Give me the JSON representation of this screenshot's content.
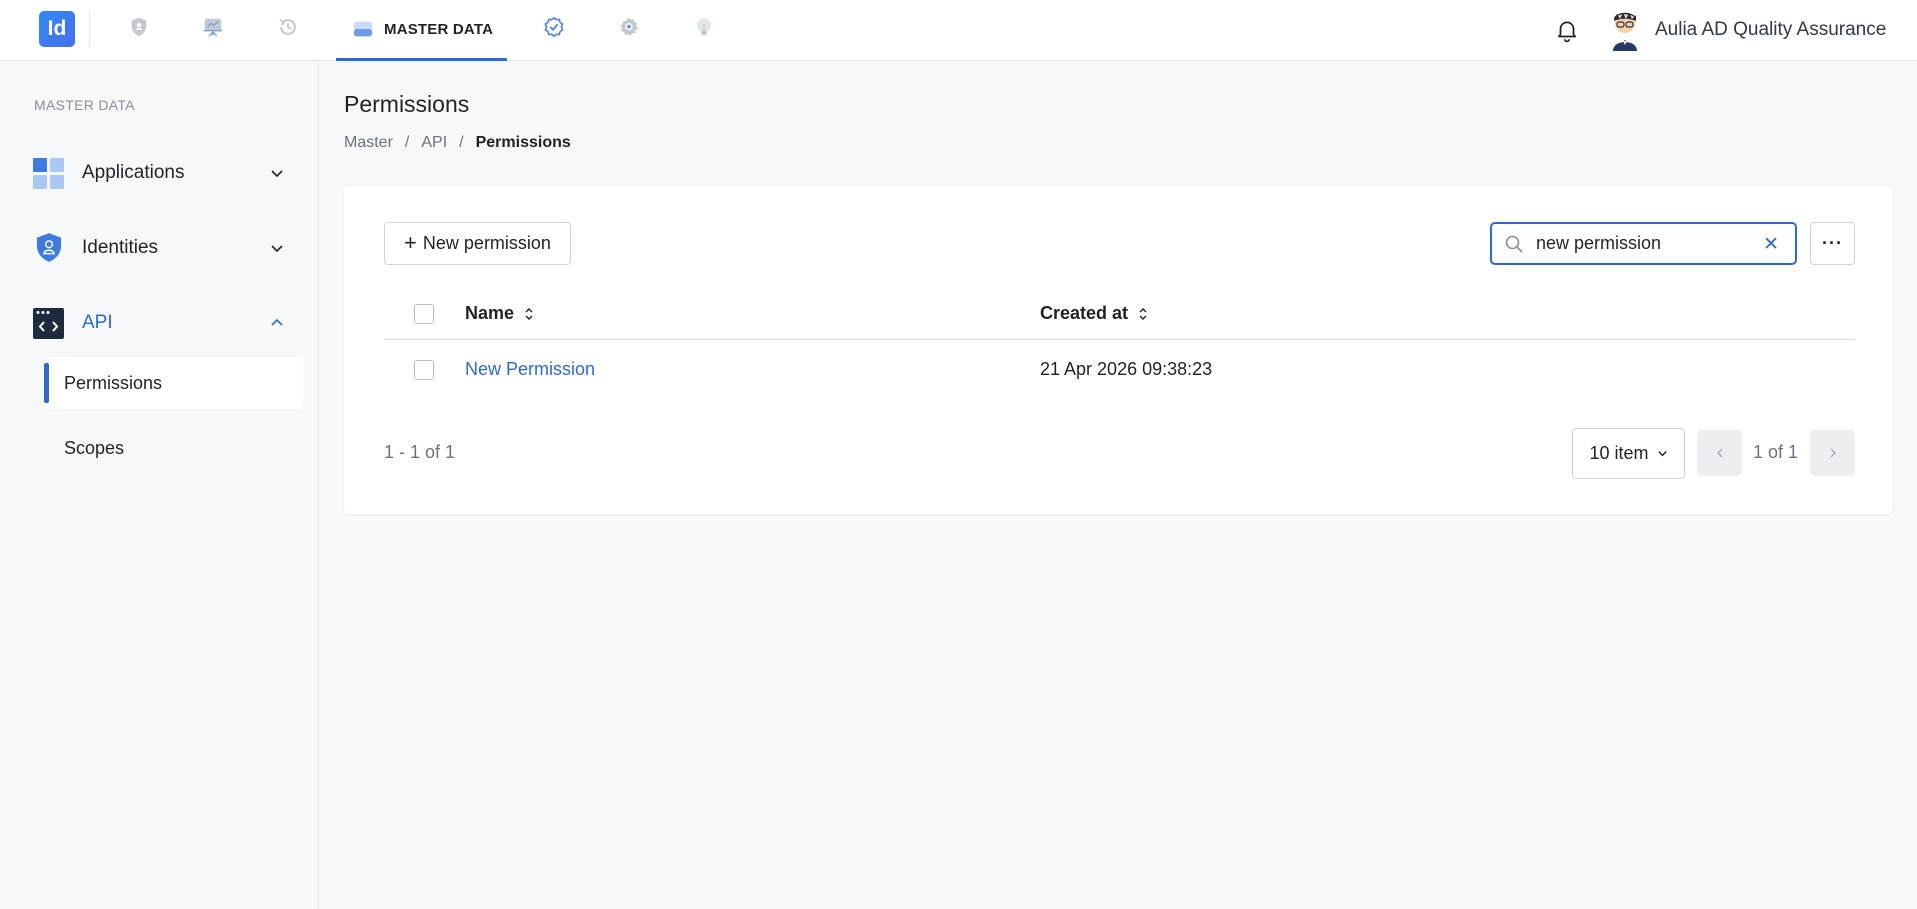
{
  "app": {
    "logo_text": "Id"
  },
  "topnav": {
    "items": [
      {
        "icon": "shield-icon"
      },
      {
        "icon": "presentation-icon"
      },
      {
        "icon": "history-icon"
      },
      {
        "icon": "database-icon",
        "label": "MASTER DATA",
        "active": true
      },
      {
        "icon": "check-badge-icon"
      },
      {
        "icon": "gear-icon"
      },
      {
        "icon": "lightbulb-icon"
      }
    ],
    "user_name": "Aulia AD Quality Assurance"
  },
  "sidebar": {
    "section_title": "MASTER DATA",
    "items": [
      {
        "label": "Applications",
        "icon": "grid-apps-icon",
        "expanded": false
      },
      {
        "label": "Identities",
        "icon": "shield-user-icon",
        "expanded": false
      },
      {
        "label": "API",
        "icon": "code-window-icon",
        "expanded": true
      }
    ],
    "sub_items": [
      {
        "label": "Permissions",
        "active": true
      },
      {
        "label": "Scopes",
        "active": false
      }
    ]
  },
  "page": {
    "title": "Permissions",
    "breadcrumb": [
      "Master",
      "API",
      "Permissions"
    ]
  },
  "toolbar": {
    "new_button_label": "New permission",
    "new_button_plus": "+",
    "search_value": "new permission",
    "clear_glyph": "✕",
    "more_glyph": "···"
  },
  "table": {
    "columns": [
      "Name",
      "Created at"
    ],
    "rows": [
      {
        "name": "New Permission",
        "created_at": "21 Apr 2026 09:38:23"
      }
    ]
  },
  "pagination": {
    "range_text": "1 - 1 of 1",
    "page_size": "10 item",
    "page_info": "1 of 1"
  },
  "colors": {
    "accent": "#2d6bd3",
    "background": "#f7f8fa"
  }
}
